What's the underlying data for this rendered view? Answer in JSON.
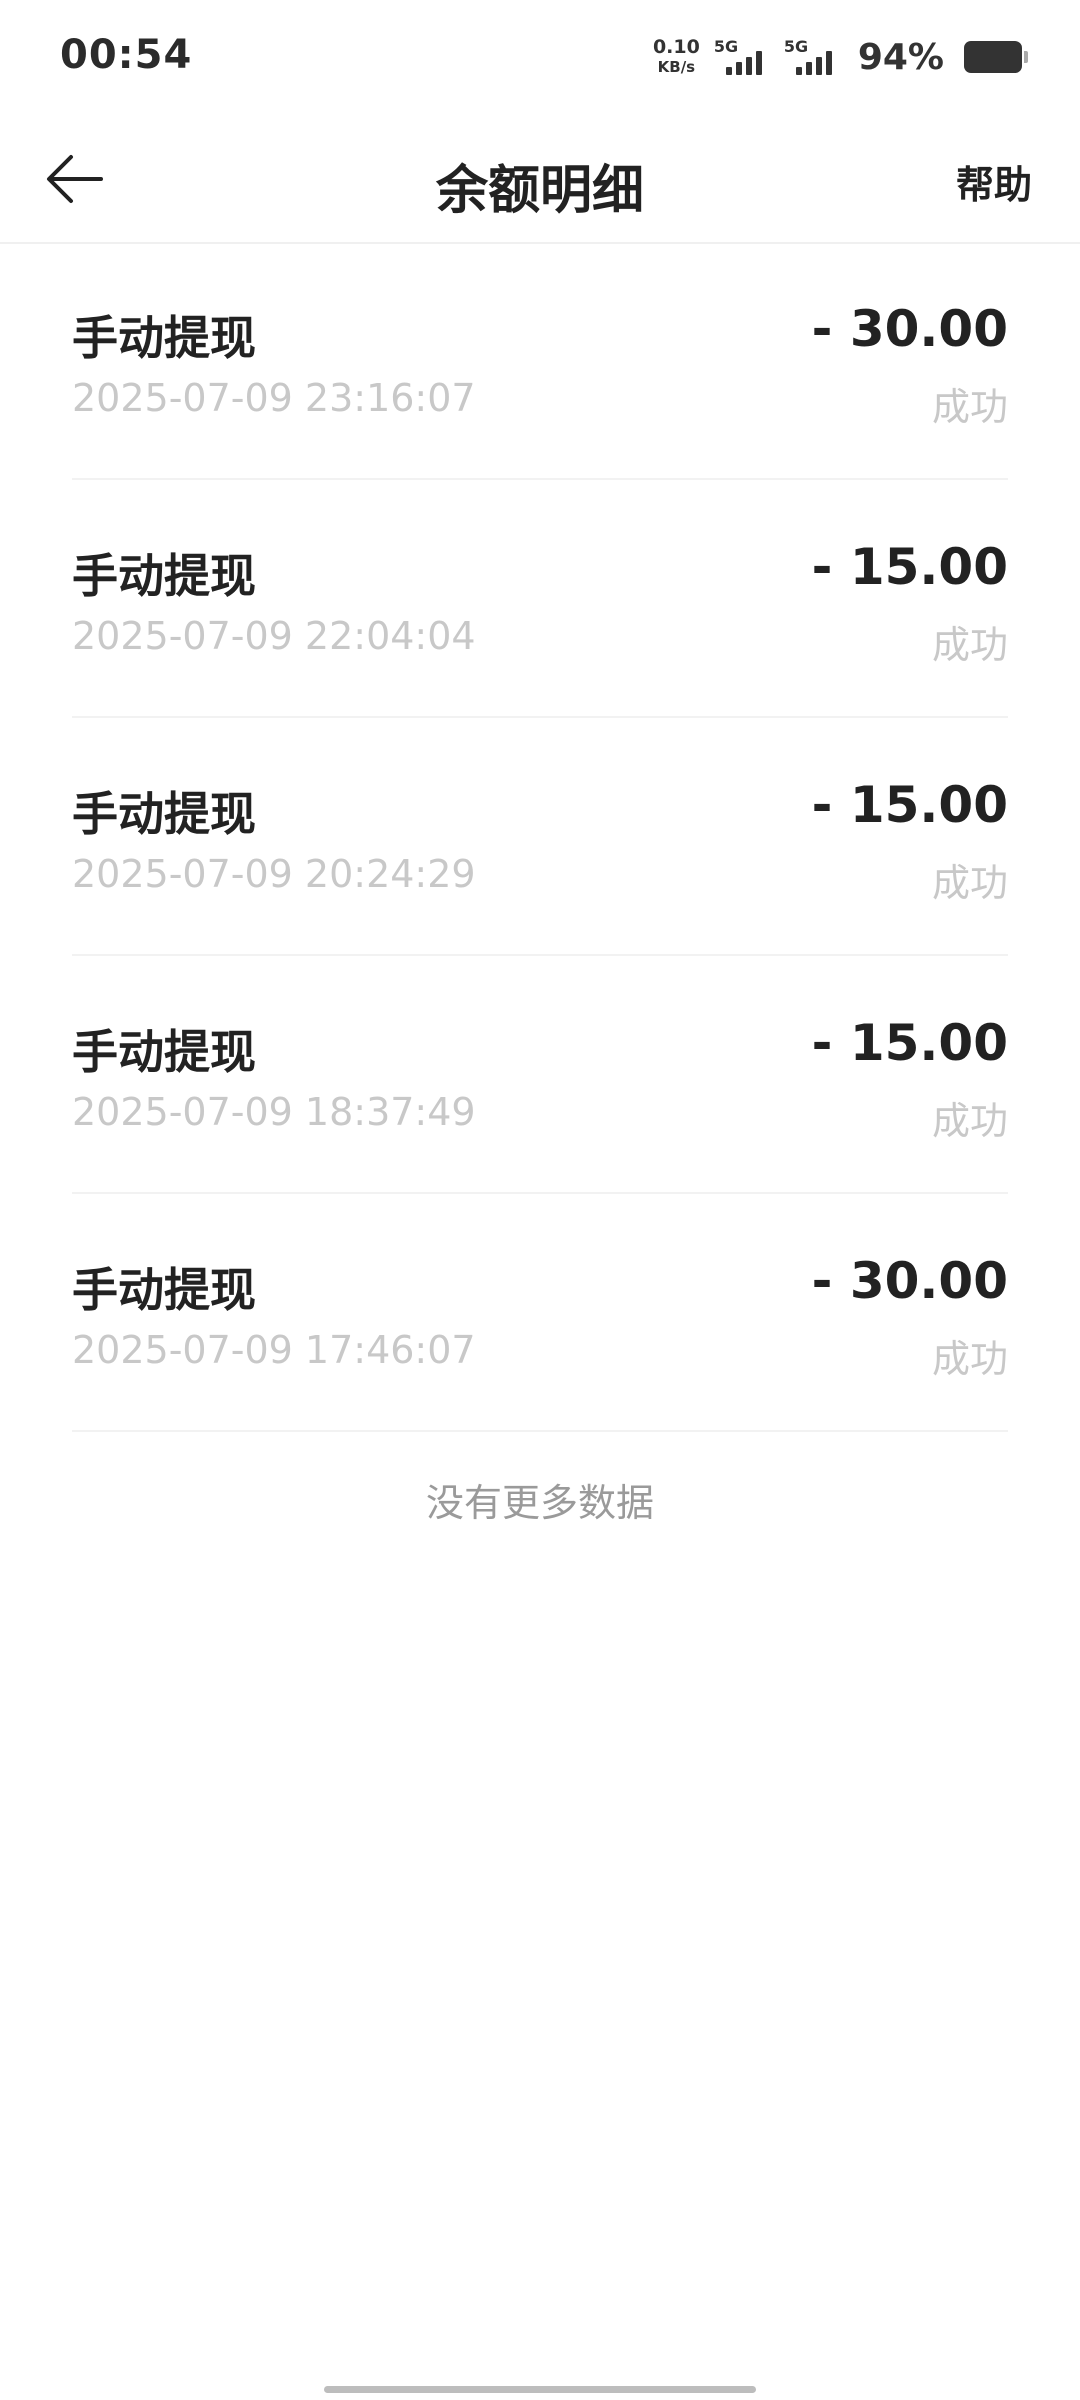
{
  "status_bar": {
    "time": "00:54",
    "net_speed_value": "0.10",
    "net_speed_unit": "KB/s",
    "sim1_label": "5G",
    "sim2_label": "5G",
    "battery_percent": "94%",
    "battery_level": 0.94
  },
  "nav": {
    "title": "余额明细",
    "help_label": "帮助",
    "back_icon": "arrow-left-icon"
  },
  "records": [
    {
      "title": "手动提现",
      "time": "2025-07-09 23:16:07",
      "amount": "- 30.00",
      "status": "成功"
    },
    {
      "title": "手动提现",
      "time": "2025-07-09 22:04:04",
      "amount": "- 15.00",
      "status": "成功"
    },
    {
      "title": "手动提现",
      "time": "2025-07-09 20:24:29",
      "amount": "- 15.00",
      "status": "成功"
    },
    {
      "title": "手动提现",
      "time": "2025-07-09 18:37:49",
      "amount": "- 15.00",
      "status": "成功"
    },
    {
      "title": "手动提现",
      "time": "2025-07-09 17:46:07",
      "amount": "- 30.00",
      "status": "成功"
    }
  ],
  "footer": {
    "no_more_text": "没有更多数据"
  },
  "colors": {
    "text_primary": "#222222",
    "text_secondary": "#c8c8c8",
    "divider": "#f2f2f2"
  }
}
